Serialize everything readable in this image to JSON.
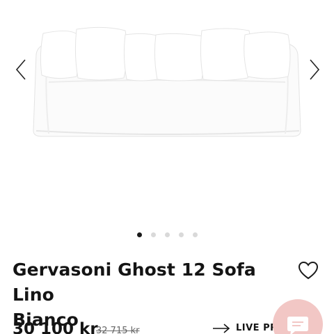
{
  "gallery": {
    "image_alt": "white sofa",
    "icons": {
      "prev": "chevron-left-icon",
      "next": "chevron-right-icon"
    },
    "slides_total": 5,
    "active_slide": 1
  },
  "product": {
    "title_line1": "Gervasoni Ghost 12 Sofa Lino",
    "title_line2": "Bianco",
    "price": "30 100 kr",
    "old_price": "32 715 kr",
    "live_label": "LIVE PR"
  },
  "colors": {
    "dot_active": "#1a1a1a",
    "dot_inactive": "#d9d9d9",
    "chat_bubble": "#f2c7c5"
  },
  "icons": {
    "wishlist": "heart-icon",
    "live": "arrow-right-icon",
    "chat": "chat-icon"
  }
}
